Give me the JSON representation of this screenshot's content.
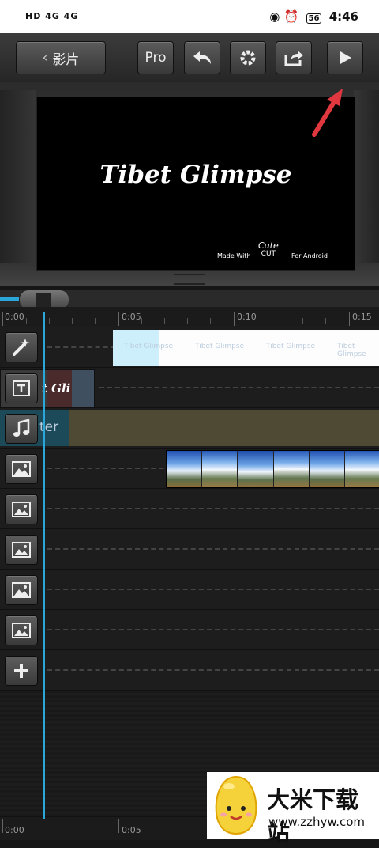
{
  "status": {
    "left": "HD 4G 4G",
    "battery": "56",
    "time": "4:46"
  },
  "toolbar": {
    "back_label": "影片",
    "pro_label": "Pro"
  },
  "preview": {
    "title": "Tibet Glimpse",
    "made_with": "Made With",
    "brand_line1": "Cute",
    "brand_line2": "CUT",
    "for_android": "For Android"
  },
  "ruler": {
    "labels": [
      "0:00",
      "0:05",
      "0:10",
      "0:15"
    ]
  },
  "tracks": {
    "text_clip": "Tibet Glimpse",
    "title_clip_partial": "t Gli",
    "music_clip_partial": "ter"
  },
  "bottom_ruler": {
    "labels": [
      "0:00",
      "0:05"
    ]
  },
  "watermark": {
    "name": "大米下载站",
    "url": "www.zzhyw.com"
  },
  "colors": {
    "accent": "#2aa7d8",
    "music_clip": "#4e4a33",
    "text_clip": "#fdfdfd"
  }
}
